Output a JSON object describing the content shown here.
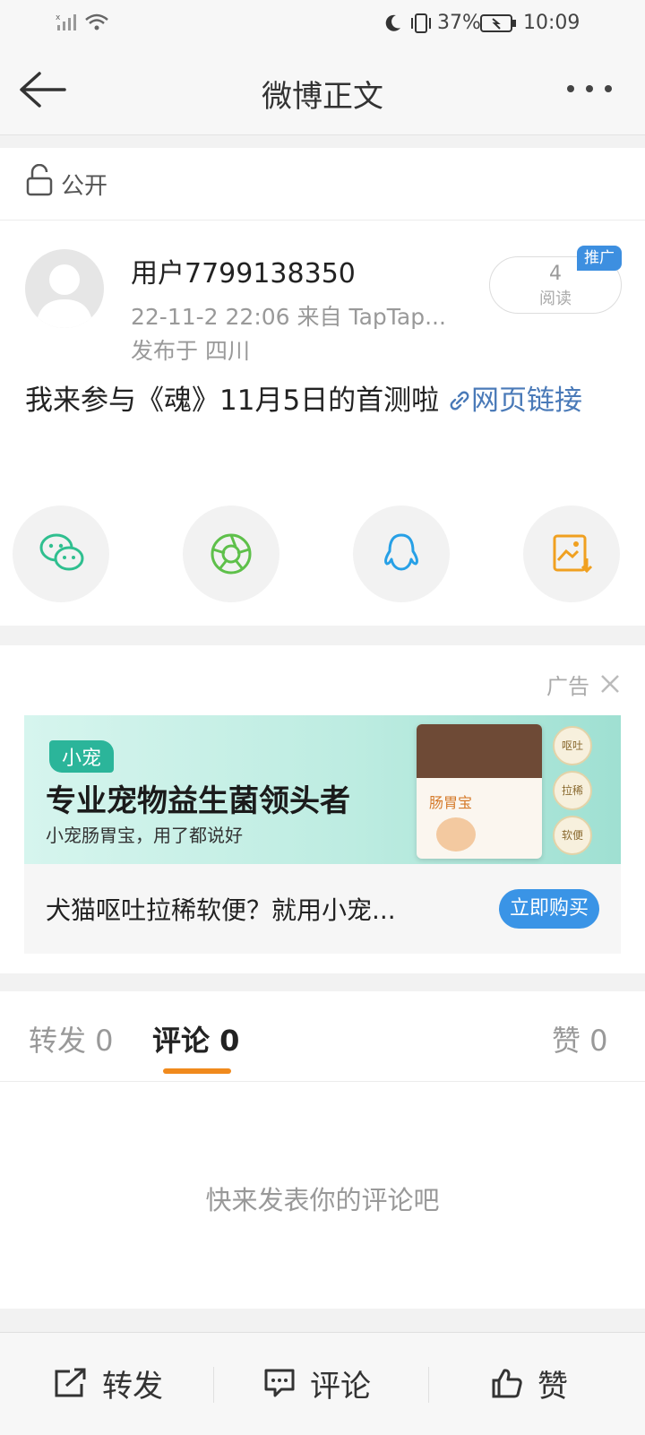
{
  "status_bar": {
    "battery": "37%",
    "time": "10:09"
  },
  "header": {
    "title": "微博正文"
  },
  "visibility": {
    "label": "公开"
  },
  "post": {
    "username": "用户7799138350",
    "time_source": "22-11-2 22:06  来自 TapTap...",
    "location": "发布于 四川",
    "read_count": "4",
    "read_label": "阅读",
    "promo_badge": "推广",
    "text": "我来参与《魂》11月5日的首测啦 ",
    "link_text": "网页链接"
  },
  "share_icons": [
    "wechat-icon",
    "moments-icon",
    "qq-icon",
    "save-image-icon"
  ],
  "ad": {
    "label": "广告",
    "brand": "小宠",
    "headline": "专业宠物益生菌领头者",
    "subline": "小宠肠胃宝，用了都说好",
    "description": "犬猫呕吐拉稀软便？就用小宠...",
    "cta": "立即购买",
    "badges": [
      "呕吐",
      "拉稀",
      "软便"
    ],
    "product_label": "肠胃宝",
    "accent_color": "#3a94e6"
  },
  "tabs": {
    "repost": "转发 0",
    "comment": "评论 0",
    "like": "赞 0",
    "active": "comment",
    "active_color": "#f08a1d"
  },
  "empty_state": "快来发表你的评论吧",
  "bottom_bar": {
    "repost": "转发",
    "comment": "评论",
    "like": "赞"
  }
}
